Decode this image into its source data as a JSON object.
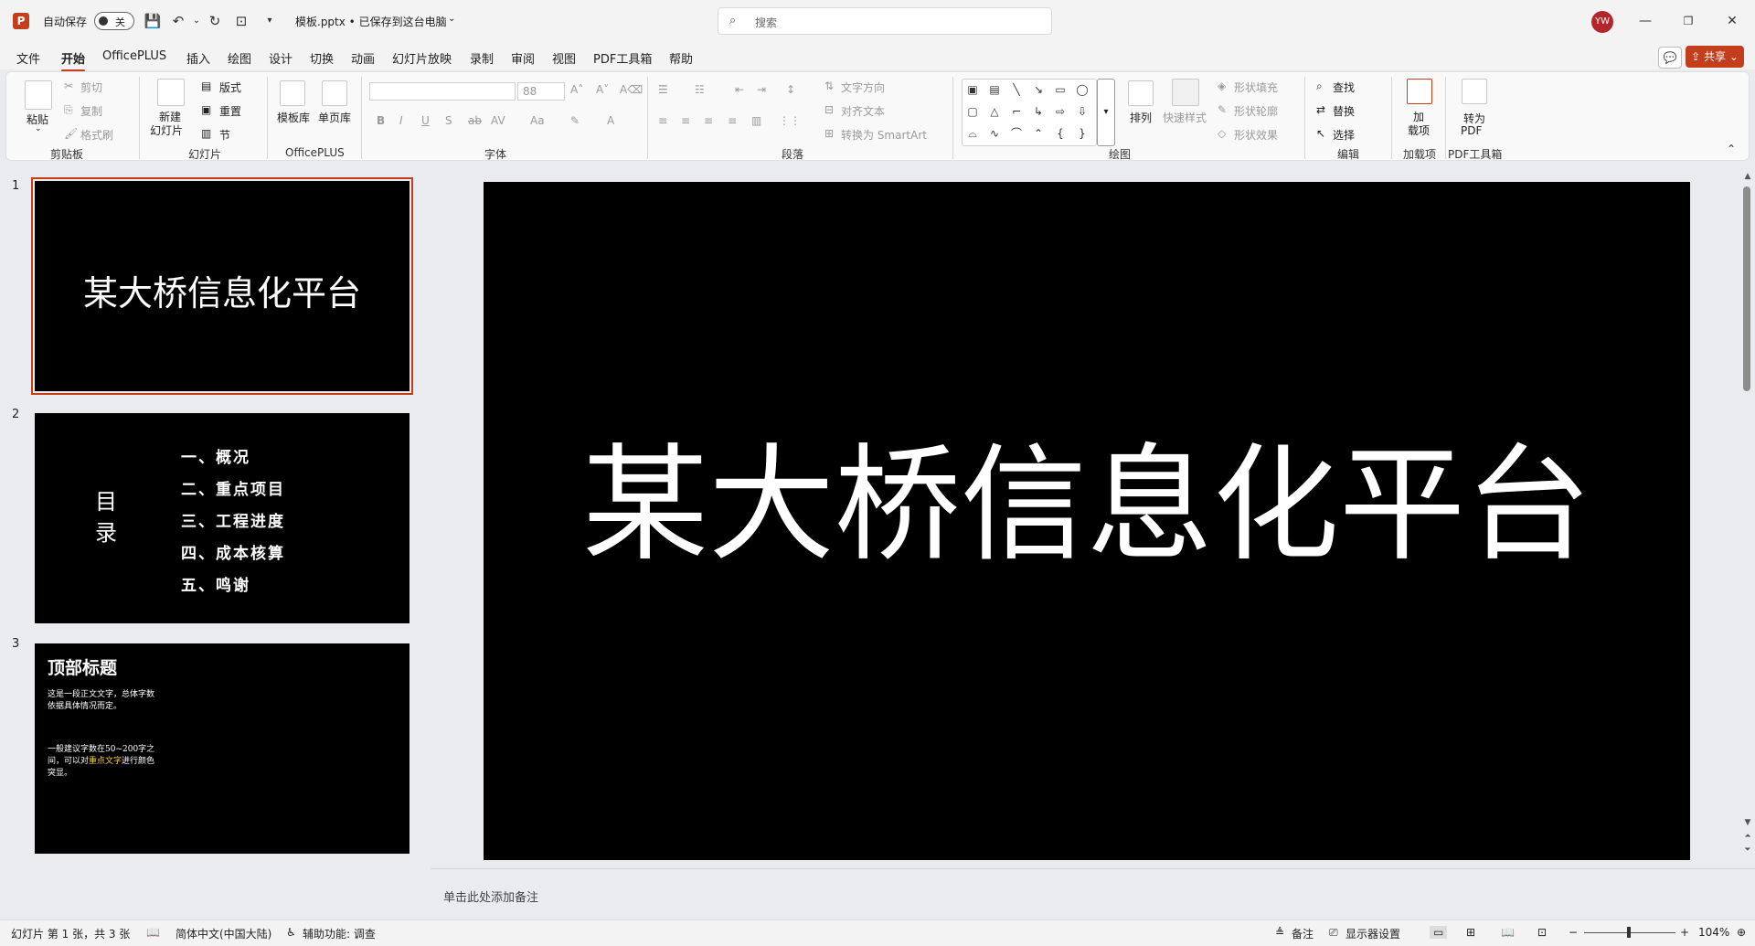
{
  "title_bar": {
    "autosave_label": "自动保存",
    "autosave_state": "关",
    "document": "模板.pptx • 已保存到这台电脑",
    "search_placeholder": "搜索",
    "avatar_initials": "YW"
  },
  "menu": {
    "tabs": [
      "文件",
      "开始",
      "OfficePLUS",
      "插入",
      "绘图",
      "设计",
      "切换",
      "动画",
      "幻灯片放映",
      "录制",
      "审阅",
      "视图",
      "PDF工具箱",
      "帮助"
    ],
    "active_tab": "开始",
    "share_label": "共享"
  },
  "ribbon": {
    "clipboard": {
      "paste": "粘贴",
      "cut": "剪切",
      "copy": "复制",
      "format_painter": "格式刷",
      "group": "剪贴板"
    },
    "slides": {
      "new_slide_line1": "新建",
      "new_slide_line2": "幻灯片",
      "layout": "版式",
      "reset": "重置",
      "section": "节",
      "group": "幻灯片"
    },
    "officeplus": {
      "template_library": "模板库",
      "single_page_library": "单页库",
      "group": "OfficePLUS"
    },
    "font": {
      "font_size": "88",
      "group": "字体"
    },
    "paragraph": {
      "text_direction": "文字方向",
      "align_text": "对齐文本",
      "convert_smartart": "转换为 SmartArt",
      "group": "段落"
    },
    "drawing": {
      "arrange": "排列",
      "quick_styles": "快速样式",
      "shape_fill": "形状填充",
      "shape_outline": "形状轮廓",
      "shape_effects": "形状效果",
      "group": "绘图"
    },
    "editing": {
      "find": "查找",
      "replace": "替换",
      "select": "选择",
      "group": "编辑"
    },
    "addins": {
      "label_line1": "加",
      "label_line2": "载项",
      "group": "加载项"
    },
    "pdf": {
      "label_line1": "转为",
      "label_line2": "PDF",
      "group": "PDF工具箱"
    }
  },
  "slides": [
    {
      "number": "1",
      "title": "某大桥信息化平台"
    },
    {
      "number": "2",
      "heading": "目录",
      "heading_line1": "目",
      "heading_line2": "录",
      "items": [
        "一、概况",
        "二、重点项目",
        "三、工程进度",
        "四、成本核算",
        "五、鸣谢"
      ]
    },
    {
      "number": "3",
      "title": "顶部标题",
      "body_1": "这是一段正文文字，总体字数依据具体情况而定。",
      "body_2_pre": "一般建议字数在50~200字之间，可以对",
      "body_2_highlight": "重点文字",
      "body_2_post": "进行颜色突显。"
    }
  ],
  "editor": {
    "current_title": "某大桥信息化平台",
    "notes_placeholder": "单击此处添加备注"
  },
  "status_bar": {
    "slide_info": "幻灯片 第 1 张，共 3 张",
    "language": "简体中文(中国大陆)",
    "accessibility": "辅助功能: 调查",
    "notes": "备注",
    "display_settings": "显示器设置",
    "zoom": "104%"
  },
  "colors": {
    "accent": "#c43e1c",
    "slide_background": "#000000",
    "highlight_text": "#ffd21f"
  }
}
